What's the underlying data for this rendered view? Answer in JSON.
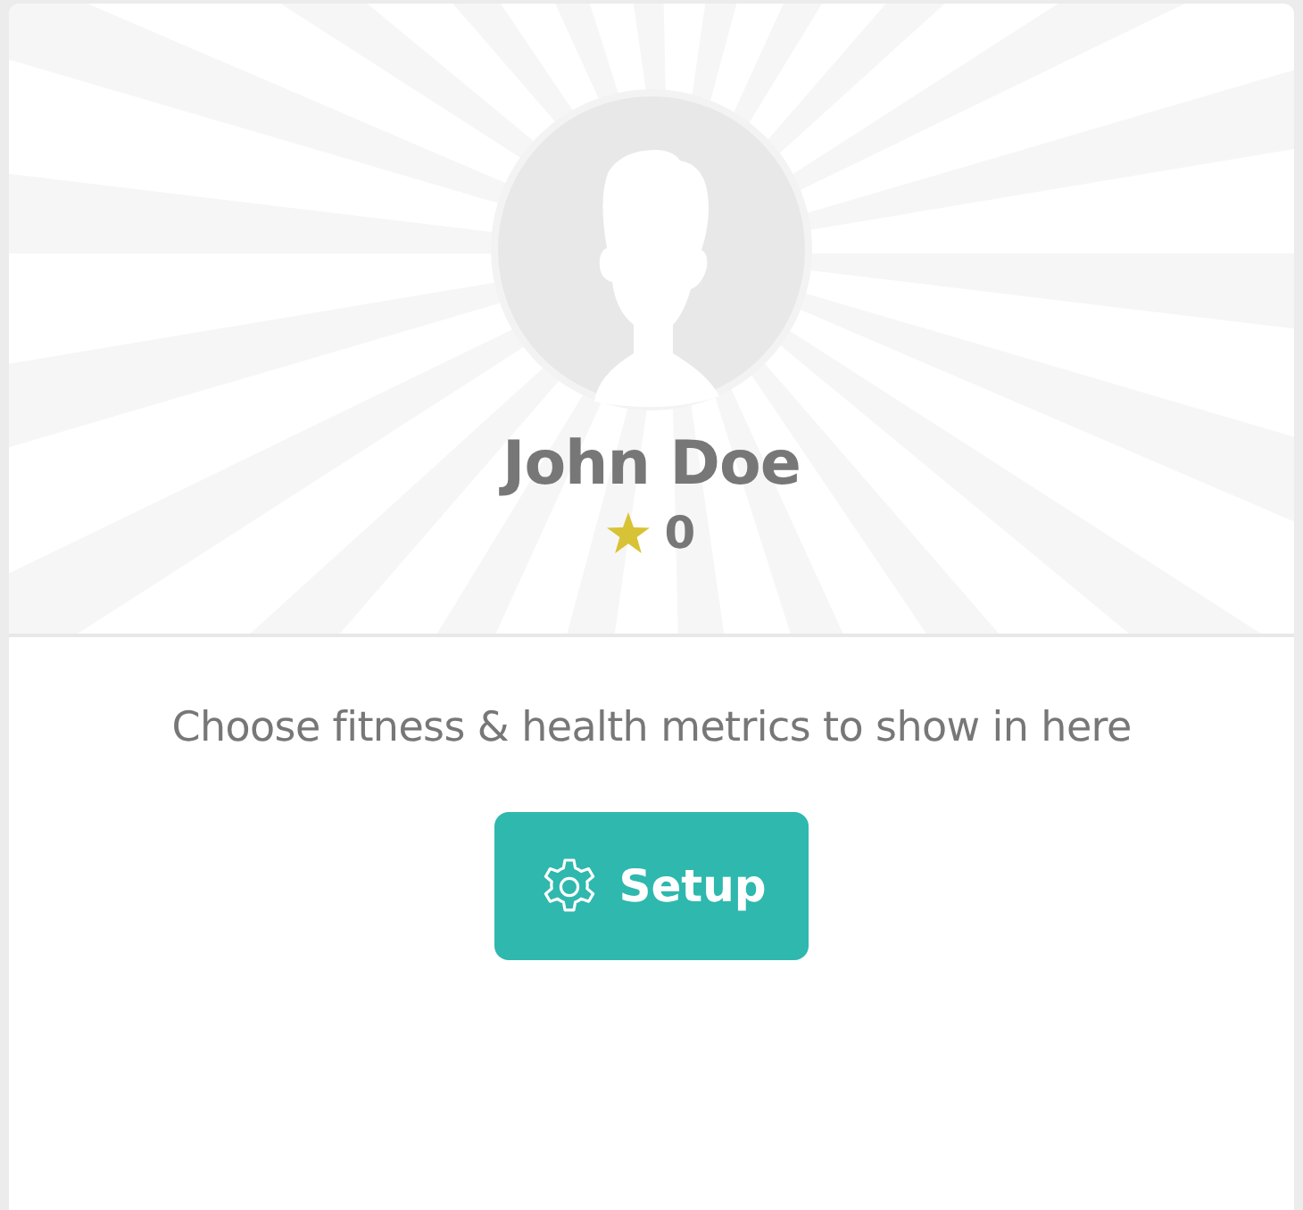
{
  "profile": {
    "name": "John Doe",
    "points": "0"
  },
  "prompt": "Choose fitness & health metrics to show in here",
  "setup_button": {
    "label": "Setup"
  }
}
